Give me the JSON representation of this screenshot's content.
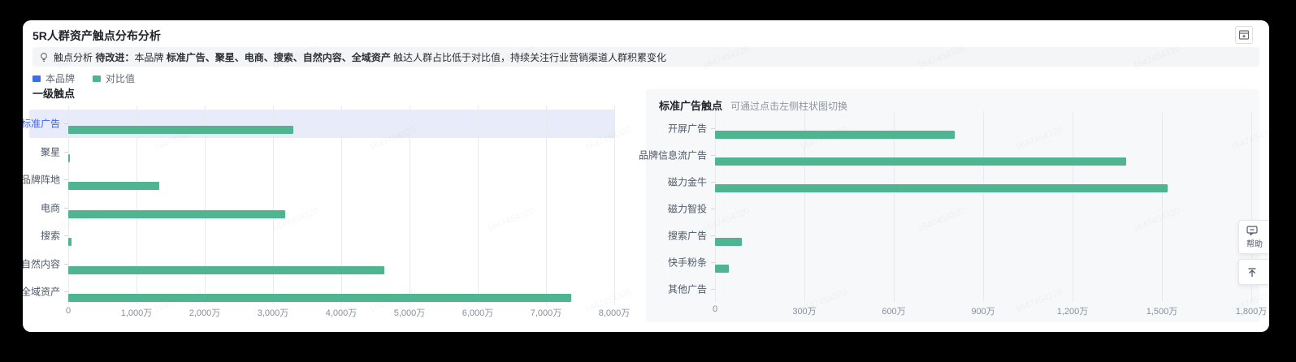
{
  "header": {
    "title": "5R人群资产触点分布分析",
    "action_icon": "add-to-dashboard-icon"
  },
  "notice": {
    "icon": "lightbulb-icon",
    "parts": [
      {
        "text": "触点分析 ",
        "bold": false
      },
      {
        "text": "待改进：",
        "bold": true
      },
      {
        "text": "本品牌 ",
        "bold": false
      },
      {
        "text": "标准广告、聚星、电商、搜索、自然内容、全域资产",
        "bold": true
      },
      {
        "text": " 触达人群占比低于对比值，持续关注行业营销渠道人群积累变化",
        "bold": false
      }
    ]
  },
  "legend": [
    {
      "label": "本品牌",
      "color": "#3b6df0"
    },
    {
      "label": "对比值",
      "color": "#4fb590"
    }
  ],
  "watermark": {
    "text": "1647454320"
  },
  "floating_buttons": [
    {
      "label": "帮助",
      "icon": "feedback-chat-icon"
    },
    {
      "label": "",
      "icon": "back-to-top-icon"
    }
  ],
  "chart_data": [
    {
      "type": "bar",
      "orientation": "horizontal",
      "title": "一级触点",
      "unit": "万",
      "categories": [
        "标准广告",
        "聚星",
        "品牌阵地",
        "电商",
        "搜索",
        "自然内容",
        "全域资产"
      ],
      "series": [
        {
          "name": "本品牌",
          "color": "#3b6df0",
          "values_wan": [
            0,
            0,
            0,
            0,
            0,
            0,
            0
          ]
        },
        {
          "name": "对比值",
          "color": "#4fb590",
          "values_wan": [
            3300,
            10,
            1330,
            3180,
            50,
            4630,
            7370
          ]
        }
      ],
      "x_ticks": [
        "0",
        "1,000万",
        "2,000万",
        "3,000万",
        "4,000万",
        "5,000万",
        "6,000万",
        "7,000万",
        "8,000万"
      ],
      "xmax_wan": 8000,
      "selected_category": "标准广告",
      "grid": true,
      "legend_position": "top-left"
    },
    {
      "type": "bar",
      "orientation": "horizontal",
      "title": "标准广告触点",
      "subtitle": "可通过点击左侧柱状图切换",
      "unit": "万",
      "categories": [
        "开屏广告",
        "品牌信息流广告",
        "磁力金牛",
        "磁力智投",
        "搜索广告",
        "快手粉条",
        "其他广告"
      ],
      "series": [
        {
          "name": "本品牌",
          "color": "#3b6df0",
          "values_wan": [
            0,
            0,
            0,
            0,
            0,
            0,
            0
          ]
        },
        {
          "name": "对比值",
          "color": "#4fb590",
          "values_wan": [
            805,
            1380,
            1520,
            0,
            90,
            45,
            0
          ]
        }
      ],
      "x_ticks": [
        "0",
        "300万",
        "600万",
        "900万",
        "1,200万",
        "1,500万",
        "1,800万"
      ],
      "xmax_wan": 1800,
      "selected_category": null,
      "grid": true
    }
  ]
}
